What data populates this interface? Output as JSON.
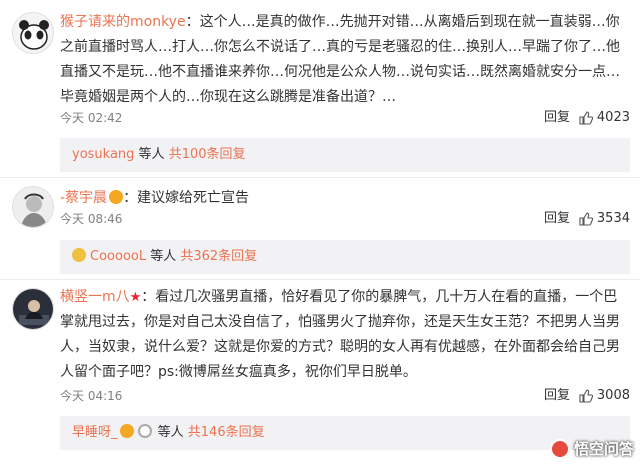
{
  "comments": [
    {
      "author": "猴子请来的monkye",
      "text": "：这个人…是真的做作…先抛开对错…从离婚后到现在就一直装弱…你之前直播时骂人…打人…你怎么不说话了…真的亏是老骚忍的住…换别人…早踹了你了…他直播又不是玩…他不直播谁来养你…何况他是公众人物…说句实话…既然离婚就安分一点…毕竟婚姻是两个人的…你现在这么跳腾是准备出道？…",
      "time": "今天 02:42",
      "reply": "回复",
      "likes": "4023",
      "sub": {
        "names": "yosukang",
        "mid": " 等人 ",
        "count": "共100条回复"
      }
    },
    {
      "author": "-蔡宇晨",
      "text": "：建议嫁给死亡宣告",
      "time": "今天 08:46",
      "reply": "回复",
      "likes": "3534",
      "sub": {
        "names": "CoooooL",
        "mid": " 等人 ",
        "count": "共362条回复"
      }
    },
    {
      "author": "横竖一m八",
      "text": "：看过几次骚男直播，恰好看见了你的暴脾气，几十万人在看的直播，一个巴掌就甩过去，你是对自己太没自信了，怕骚男火了抛弃你，还是天生女王范？不把男人当男人，当奴隶，说什么爱？这就是你爱的方式？聪明的女人再有优越感，在外面都会给自己男人留个面子吧？ps:微博屌丝女瘟真多，祝你们早日脱单。",
      "time": "今天 04:16",
      "reply": "回复",
      "likes": "3008",
      "sub": {
        "names": "早睡呀_",
        "mid": " 等人 ",
        "count": "共146条回复"
      }
    }
  ],
  "watermark": "悟空问答",
  "colors": {
    "author": "#eb7350",
    "subbg": "#f2f2f5",
    "meta": "#808080"
  }
}
